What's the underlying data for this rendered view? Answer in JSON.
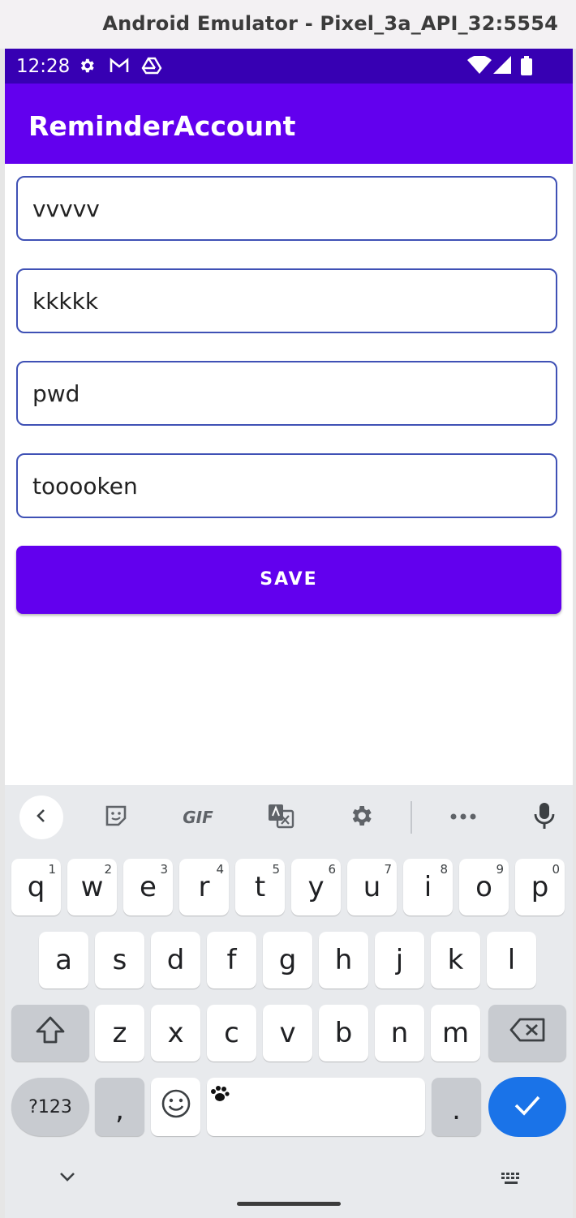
{
  "emulator": {
    "title": "Android Emulator - Pixel_3a_API_32:5554"
  },
  "status_bar": {
    "time": "12:28"
  },
  "app_bar": {
    "title": "ReminderAccount"
  },
  "form": {
    "fields": [
      {
        "value": "vvvvv"
      },
      {
        "value": "kkkkk"
      },
      {
        "value": "pwd"
      },
      {
        "value": "tooooken"
      }
    ],
    "save_label": "SAVE"
  },
  "keyboard": {
    "toolbar": {
      "gif_label": "GIF"
    },
    "row1": [
      {
        "label": "q",
        "hint": "1"
      },
      {
        "label": "w",
        "hint": "2"
      },
      {
        "label": "e",
        "hint": "3"
      },
      {
        "label": "r",
        "hint": "4"
      },
      {
        "label": "t",
        "hint": "5"
      },
      {
        "label": "y",
        "hint": "6"
      },
      {
        "label": "u",
        "hint": "7"
      },
      {
        "label": "i",
        "hint": "8"
      },
      {
        "label": "o",
        "hint": "9"
      },
      {
        "label": "p",
        "hint": "0"
      }
    ],
    "row2": [
      "a",
      "s",
      "d",
      "f",
      "g",
      "h",
      "j",
      "k",
      "l"
    ],
    "row3": [
      "z",
      "x",
      "c",
      "v",
      "b",
      "n",
      "m"
    ],
    "symbols_label": "?123",
    "comma_label": ",",
    "period_label": "."
  },
  "colors": {
    "primary": "#6200ee",
    "primary_dark": "#3700b3",
    "field_border": "#3f51b5",
    "enter_key": "#1a73e8"
  }
}
